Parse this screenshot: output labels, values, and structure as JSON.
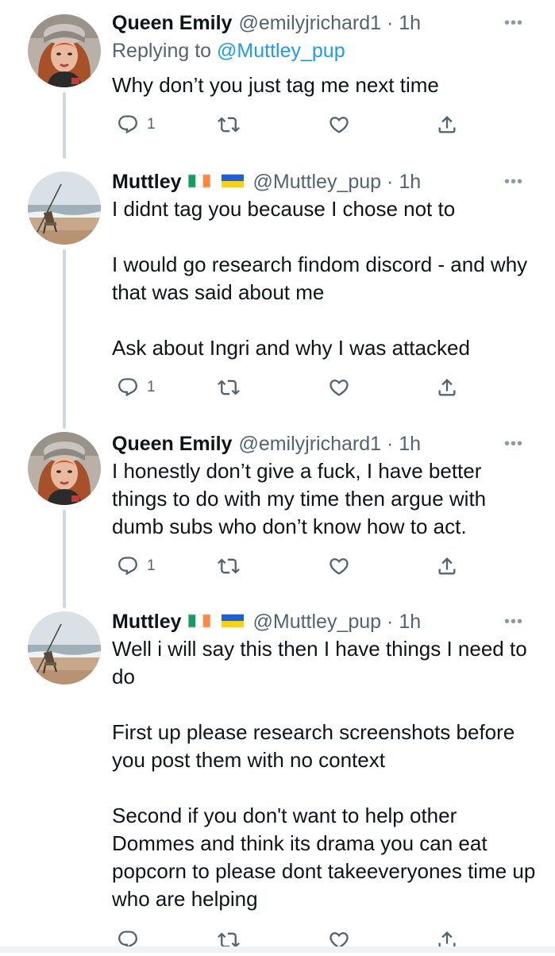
{
  "tweets": [
    {
      "name": "Queen Emily",
      "handle": "@emilyjrichard1",
      "dot": "·",
      "time": "1h",
      "reply_prefix": "Replying to",
      "reply_to": "@Muttley_pup",
      "text": "Why don’t you just tag me next time",
      "reply_count": "1",
      "avatar": "woman-portrait-avatar",
      "flags": []
    },
    {
      "name": "Muttley",
      "handle": "@Muttley_pup",
      "dot": "·",
      "time": "1h",
      "text": "I didnt tag you because I chose not to\n\nI would go research findom discord - and why that was said about me\n\nAsk about Ingri and why I was attacked",
      "reply_count": "1",
      "avatar": "beach-chair-avatar",
      "flags": [
        "ireland-flag",
        "ukraine-flag"
      ]
    },
    {
      "name": "Queen Emily",
      "handle": "@emilyjrichard1",
      "dot": "·",
      "time": "1h",
      "text": "I honestly don’t give a fuck, I have better things to do with my time then argue with dumb subs who don’t know how to act.",
      "reply_count": "1",
      "avatar": "woman-portrait-avatar",
      "flags": []
    },
    {
      "name": "Muttley",
      "handle": "@Muttley_pup",
      "dot": "·",
      "time": "1h",
      "text": "Well i will say this then I have things I need to do\n\nFirst up  please research screenshots before you post them with no context\n\nSecond if you don't want to help other Dommes and think its drama you can eat popcorn to please dont takeeveryones time up who are helping",
      "reply_count": "",
      "avatar": "beach-chair-avatar",
      "flags": [
        "ireland-flag",
        "ukraine-flag"
      ]
    }
  ],
  "icons": {
    "more": "more-options-icon",
    "reply": "reply-icon",
    "retweet": "retweet-icon",
    "like": "like-icon",
    "share": "share-icon"
  },
  "colors": {
    "text": "#0f1419",
    "secondary": "#536471",
    "link": "#1d9bf0",
    "thread_line": "#cfd9de"
  }
}
